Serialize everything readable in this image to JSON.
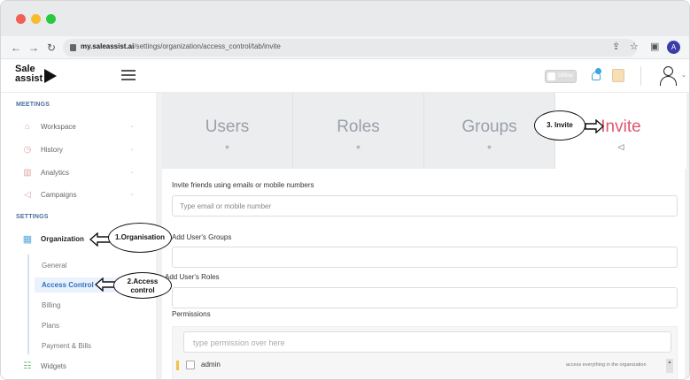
{
  "browser": {
    "url_domain": "my.saleassist.ai",
    "url_path": "/settings/organization/access_control/tab/invite",
    "profile_initial": "A"
  },
  "header": {
    "logo_line1": "Sale",
    "logo_line2": "assist",
    "status_toggle": "Offline"
  },
  "sidebar": {
    "meetings_title": "MEETINGS",
    "meetings_items": [
      {
        "label": "Workspace",
        "icon": "home-icon"
      },
      {
        "label": "History",
        "icon": "clock-icon"
      },
      {
        "label": "Analytics",
        "icon": "bar-chart-icon"
      },
      {
        "label": "Campaigns",
        "icon": "megaphone-icon"
      }
    ],
    "settings_title": "SETTINGS",
    "organization_label": "Organization",
    "sub_items": [
      "General",
      "Access Control",
      "Billing",
      "Plans",
      "Payment & Bills"
    ],
    "widgets_label": "Widgets"
  },
  "tabs": [
    {
      "label": "Users",
      "icon": "chat-icon"
    },
    {
      "label": "Roles",
      "icon": "chat-icon"
    },
    {
      "label": "Groups",
      "icon": "chat-icon"
    },
    {
      "label": "Invite",
      "icon": "megaphone-icon"
    }
  ],
  "active_tab": "Invite",
  "form": {
    "invite_label": "Invite friends using emails or mobile numbers",
    "invite_placeholder": "Type email or mobile number",
    "groups_label": "Add User's Groups",
    "roles_label": "Add User's Roles",
    "permissions_label": "Permissions",
    "permission_search_placeholder": "type permission over here",
    "permission_rows": [
      {
        "name": "admin",
        "description": "access everything in the organization"
      }
    ]
  },
  "annotations": {
    "step1": "1.Organisation",
    "step2_line1": "2.Access",
    "step2_line2": "control",
    "step3": "3. Invite"
  },
  "colors": {
    "accent_invite": "#e0566f",
    "sidebar_active": "#2f6fbf",
    "section_title": "#4a6fa0"
  }
}
